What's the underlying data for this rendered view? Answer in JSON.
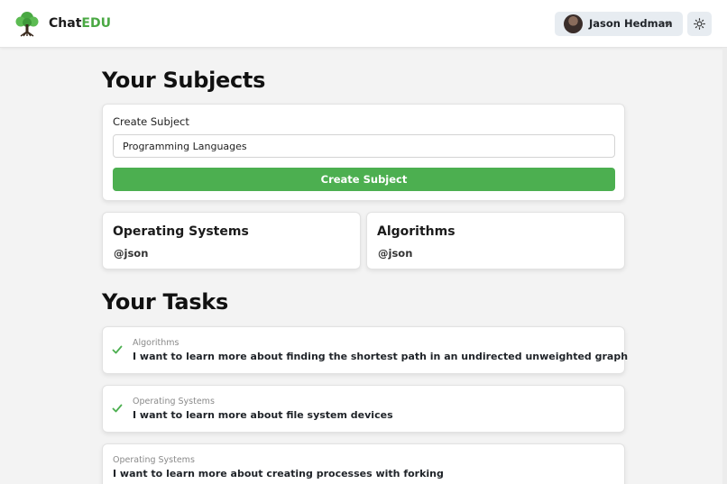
{
  "header": {
    "brand_prefix": "Chat",
    "brand_suffix": "EDU",
    "user_name": "Jason Hedman"
  },
  "colors": {
    "accent": "#4caf50",
    "brand_accent": "#4aa843",
    "background": "#f3f3f3"
  },
  "subjects_section": {
    "heading": "Your Subjects",
    "create_label": "Create Subject",
    "input_value": "Programming Languages",
    "create_button": "Create Subject",
    "cards": [
      {
        "title": "Operating Systems",
        "owner": "@json"
      },
      {
        "title": "Algorithms",
        "owner": "@json"
      }
    ]
  },
  "tasks_section": {
    "heading": "Your Tasks",
    "tasks": [
      {
        "subject": "Algorithms",
        "text": "I want to learn more about finding the shortest path in an undirected unweighted graph",
        "completed": true
      },
      {
        "subject": "Operating Systems",
        "text": "I want to learn more about file system devices",
        "completed": true
      },
      {
        "subject": "Operating Systems",
        "text": "I want to learn more about creating processes with forking",
        "completed": false
      }
    ]
  },
  "icons": [
    "tree-logo-icon",
    "chevron-down-icon",
    "sun-icon",
    "check-icon"
  ]
}
